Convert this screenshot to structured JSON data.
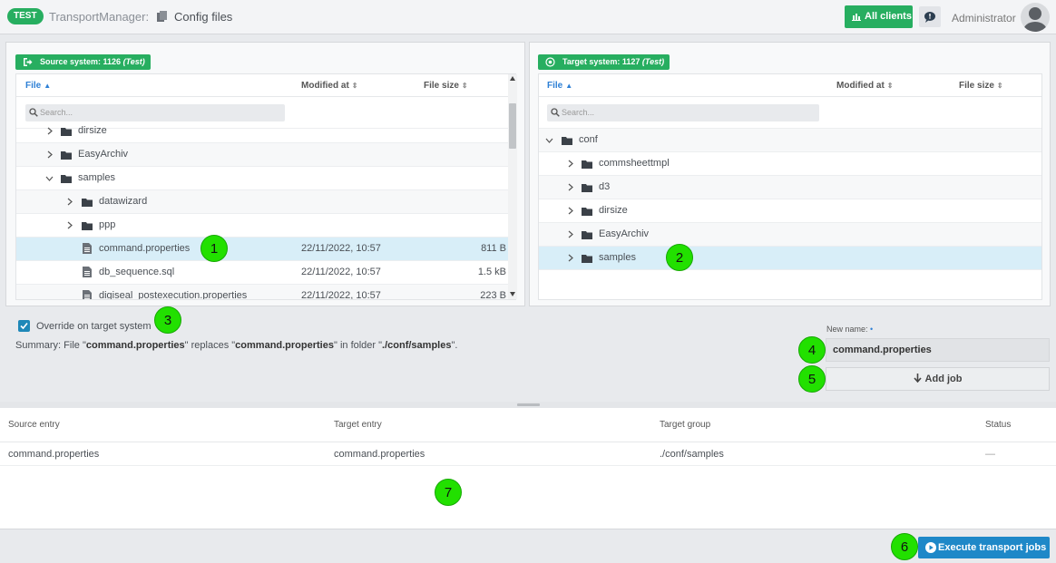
{
  "header": {
    "badge": "TEST",
    "app_title": "TransportManager:",
    "page_title": "Config files",
    "all_clients_label": "All clients",
    "user_name": "Administrator"
  },
  "source_panel": {
    "badge_prefix": "Source system: 1126",
    "badge_suffix": "(Test)",
    "columns": [
      "File",
      "Modified at",
      "File size"
    ],
    "search_placeholder": "Search...",
    "rows": [
      {
        "name": "dirsize",
        "type": "folder",
        "expanded": false,
        "modified": "",
        "size": ""
      },
      {
        "name": "EasyArchiv",
        "type": "folder",
        "expanded": false,
        "modified": "",
        "size": ""
      },
      {
        "name": "samples",
        "type": "folder",
        "expanded": true,
        "modified": "",
        "size": ""
      },
      {
        "name": "datawizard",
        "type": "folder",
        "expanded": false,
        "modified": "",
        "size": ""
      },
      {
        "name": "ppp",
        "type": "folder",
        "expanded": false,
        "modified": "",
        "size": ""
      },
      {
        "name": "command.properties",
        "type": "file",
        "modified": "22/11/2022, 10:57",
        "size": "811 B",
        "selected": true
      },
      {
        "name": "db_sequence.sql",
        "type": "file",
        "modified": "22/11/2022, 10:57",
        "size": "1.5 kB"
      },
      {
        "name": "digiseal_postexecution.properties",
        "type": "file",
        "modified": "22/11/2022, 10:57",
        "size": "223 B"
      }
    ]
  },
  "target_panel": {
    "badge_prefix": "Target system: 1127",
    "badge_suffix": "(Test)",
    "columns": [
      "File",
      "Modified at",
      "File size"
    ],
    "search_placeholder": "Search...",
    "rows": [
      {
        "name": "conf",
        "type": "folder",
        "expanded": true
      },
      {
        "name": "commsheettmpl",
        "type": "folder",
        "expanded": false
      },
      {
        "name": "d3",
        "type": "folder",
        "expanded": false
      },
      {
        "name": "dirsize",
        "type": "folder",
        "expanded": false
      },
      {
        "name": "EasyArchiv",
        "type": "folder",
        "expanded": false
      },
      {
        "name": "samples",
        "type": "folder",
        "expanded": false,
        "selected": true
      }
    ]
  },
  "options": {
    "override_label": "Override on target system",
    "override_checked": true,
    "summary_1": "Summary: File \"",
    "summary_file": "command.properties",
    "summary_2": "\" replaces \"",
    "summary_target": "command.properties",
    "summary_3": "\" in folder \"",
    "summary_folder": "./conf/samples",
    "summary_4": "\".",
    "new_name_label": "New name:",
    "new_name_required": "•",
    "new_name_value": "command.properties",
    "add_job_label": "Add job"
  },
  "jobs": {
    "columns": [
      "Source entry",
      "Target entry",
      "Target group",
      "Status"
    ],
    "rows": [
      {
        "source": "command.properties",
        "target": "command.properties",
        "group": "./conf/samples",
        "status": "—"
      }
    ]
  },
  "footer": {
    "execute_label": "Execute transport jobs"
  },
  "markers": [
    "1",
    "2",
    "3",
    "4",
    "5",
    "6",
    "7"
  ],
  "colors": {
    "green": "#27ae60",
    "blue": "#1e88c8",
    "selection": "#d8eef8",
    "marker": "#22e000"
  }
}
